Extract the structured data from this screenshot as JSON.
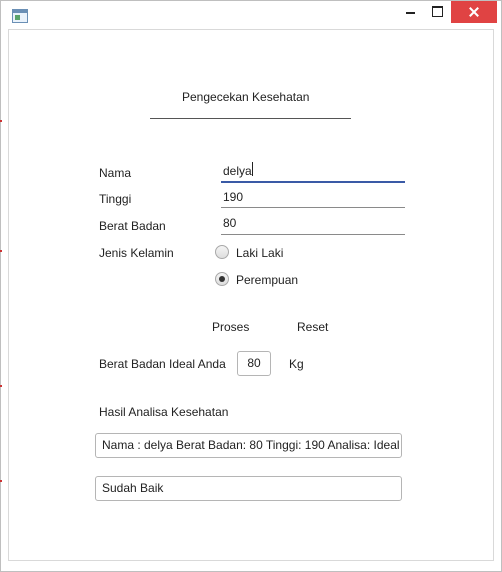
{
  "titlebar": {
    "title": "",
    "icons": [
      "app-icon",
      "minimize-icon",
      "maximize-icon",
      "close-icon"
    ]
  },
  "form": {
    "title": "Pengecekan Kesehatan",
    "nama": {
      "label": "Nama",
      "value": "delya"
    },
    "tinggi": {
      "label": "Tinggi",
      "value": "190"
    },
    "berat": {
      "label": "Berat Badan",
      "value": "80"
    },
    "jenis_kelamin": {
      "label": "Jenis Kelamin",
      "options": [
        "Laki Laki",
        "Perempuan"
      ],
      "selected": "Perempuan"
    },
    "proses_label": "Proses",
    "reset_label": "Reset",
    "ideal": {
      "label": "Berat Badan Ideal Anda",
      "value": "80",
      "unit": "Kg"
    },
    "hasil": {
      "label": "Hasil Analisa Kesehatan",
      "result": "Nama : delya Berat Badan: 80 Tinggi: 190 Analisa: Ideal",
      "status": "Sudah Baik"
    }
  },
  "colors": {
    "accent": "#3a5aa6",
    "close": "#e04343"
  }
}
